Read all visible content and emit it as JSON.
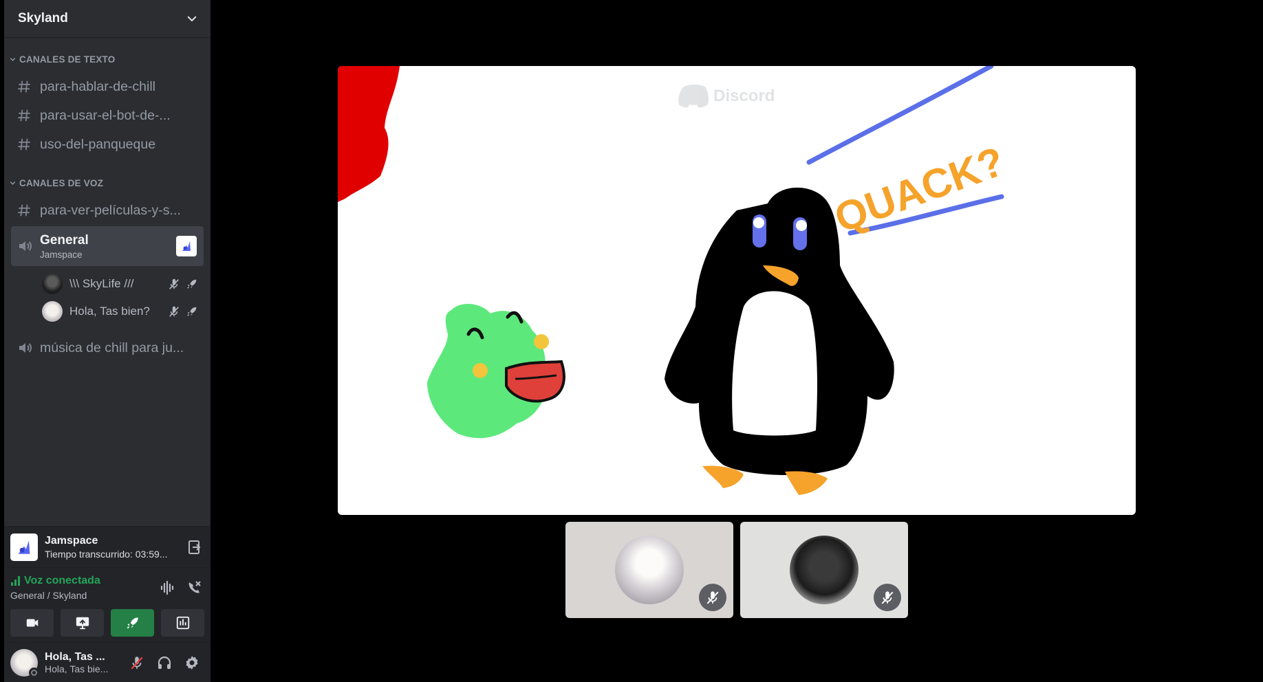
{
  "server": {
    "name": "Skyland"
  },
  "categories": {
    "text": "CANALES DE TEXTO",
    "voice": "CANALES DE VOZ"
  },
  "text_channels": [
    "para-hablar-de-chill",
    "para-usar-el-bot-de-...",
    "uso-del-panqueque"
  ],
  "voice_channels": {
    "first": "para-ver-películas-y-s...",
    "general": {
      "name": "General",
      "activity": "Jamspace"
    },
    "users": [
      {
        "name": "\\\\\\ SkyLife ///"
      },
      {
        "name": "Hola, Tas bien?"
      }
    ],
    "music": "música de chill para ju..."
  },
  "activity_panel": {
    "name": "Jamspace",
    "elapsed": "Tiempo transcurrido: 03:59..."
  },
  "voice_panel": {
    "status": "Voz conectada",
    "location": "General / Skyland"
  },
  "user_panel": {
    "display_name": "Hola, Tas ...",
    "username": "Hola, Tas bie..."
  },
  "canvas": {
    "watermark": "Discord",
    "quack_text": "QUACK?"
  },
  "colors": {
    "sidebar": "#2b2d31",
    "panel": "#232428",
    "green": "#23a559",
    "blurple": "#5865f2"
  },
  "icons": [
    "chevron-down-icon",
    "hash-icon",
    "speaker-icon",
    "mic-muted-icon",
    "rocket-icon",
    "disconnect-icon",
    "camera-icon",
    "screen-share-icon",
    "soundboard-icon",
    "headphones-icon",
    "gear-icon"
  ]
}
